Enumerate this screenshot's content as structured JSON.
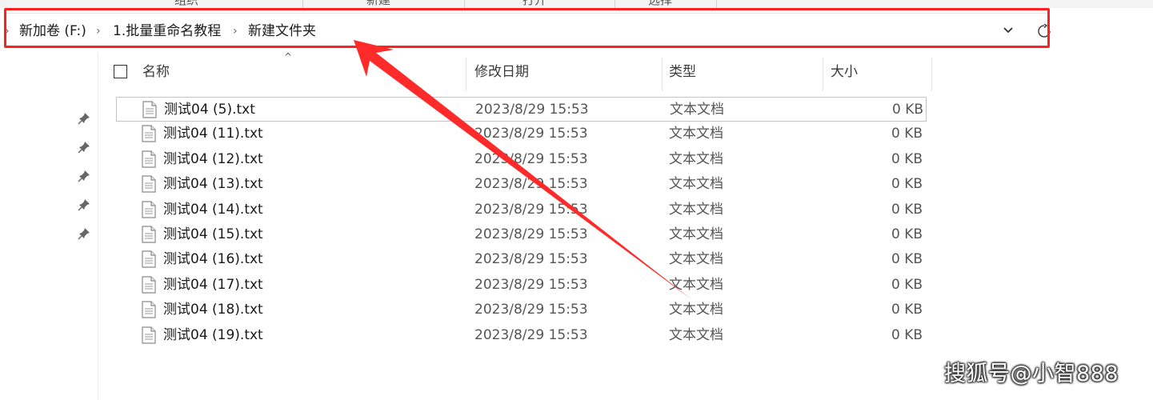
{
  "ribbon": {
    "items": [
      "组织",
      "新建",
      "打开",
      "选择"
    ]
  },
  "address": {
    "breadcrumbs": [
      "新加卷 (F:)",
      "1.批量重命名教程",
      "新建文件夹"
    ]
  },
  "columns": {
    "name": "名称",
    "date": "修改日期",
    "type": "类型",
    "size": "大小"
  },
  "files": [
    {
      "name": "测试04 (5).txt",
      "date": "2023/8/29 15:53",
      "type": "文本文档",
      "size": "0 KB"
    },
    {
      "name": "测试04 (11).txt",
      "date": "2023/8/29 15:53",
      "type": "文本文档",
      "size": "0 KB"
    },
    {
      "name": "测试04 (12).txt",
      "date": "2023/8/29 15:53",
      "type": "文本文档",
      "size": "0 KB"
    },
    {
      "name": "测试04 (13).txt",
      "date": "2023/8/29 15:53",
      "type": "文本文档",
      "size": "0 KB"
    },
    {
      "name": "测试04 (14).txt",
      "date": "2023/8/29 15:53",
      "type": "文本文档",
      "size": "0 KB"
    },
    {
      "name": "测试04 (15).txt",
      "date": "2023/8/29 15:53",
      "type": "文本文档",
      "size": "0 KB"
    },
    {
      "name": "测试04 (16).txt",
      "date": "2023/8/29 15:53",
      "type": "文本文档",
      "size": "0 KB"
    },
    {
      "name": "测试04 (17).txt",
      "date": "2023/8/29 15:53",
      "type": "文本文档",
      "size": "0 KB"
    },
    {
      "name": "测试04 (18).txt",
      "date": "2023/8/29 15:53",
      "type": "文本文档",
      "size": "0 KB"
    },
    {
      "name": "测试04 (19).txt",
      "date": "2023/8/29 15:53",
      "type": "文本文档",
      "size": "0 KB"
    }
  ],
  "watermark": "搜狐号@小智888",
  "colors": {
    "highlight": "#ff2020",
    "selected_border": "#a8cbe8"
  }
}
